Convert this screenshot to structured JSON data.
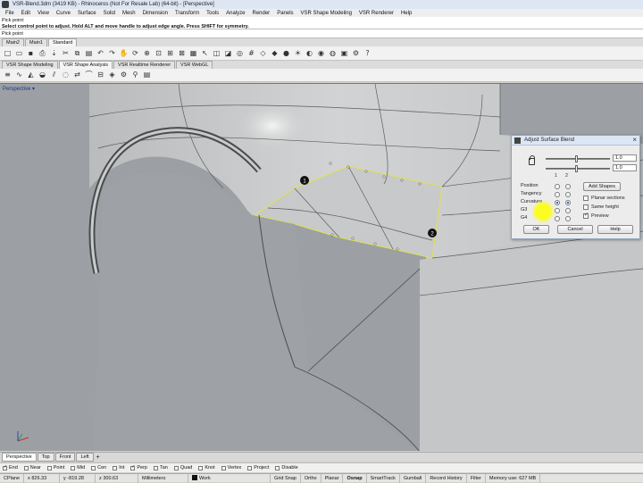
{
  "window": {
    "title": "VSR-Blend.3dm (3419 KB) - Rhinoceros (Not For Resale Lab) (64-bit) - [Perspective]"
  },
  "menu": [
    "File",
    "Edit",
    "View",
    "Curve",
    "Surface",
    "Solid",
    "Mesh",
    "Dimension",
    "Transform",
    "Tools",
    "Analyze",
    "Render",
    "Panels",
    "VSR Shape Modeling",
    "VSR Renderer",
    "Help"
  ],
  "command": {
    "history_line": "Pick point:",
    "message": "Select control point to adjust. Hold ALT and move handle to adjust edge angle. Press SHIFT for symmetry.",
    "prompt": "Pick point"
  },
  "toolbar_tabs_top": [
    "Main2",
    "Main1",
    "Standard"
  ],
  "toolbar_tabs_top_active": 2,
  "toolbar_tabs_vsr": [
    "VSR Shape Modeling",
    "VSR Shape Analysis",
    "VSR Realtime Renderer",
    "VSR WebGL"
  ],
  "toolbar_tabs_vsr_active": 1,
  "viewport": {
    "label": "Perspective",
    "markers": [
      "1",
      "2"
    ]
  },
  "dialog": {
    "title": "Adjust Surface Blend",
    "field1": "1.0",
    "field2": "1.0",
    "column_headers": [
      "1",
      "2"
    ],
    "rows": [
      "Position",
      "Tangency",
      "Curvature",
      "G3",
      "G4"
    ],
    "selected_side1": "Curvature",
    "selected_side2": "Curvature",
    "add_shapes": "Add Shapes",
    "checkboxes": [
      {
        "label": "Planar sections",
        "checked": false
      },
      {
        "label": "Same height",
        "checked": false
      },
      {
        "label": "Preview",
        "checked": true
      }
    ],
    "ok": "OK",
    "cancel": "Cancel",
    "help": "Help"
  },
  "view_tabs": [
    "Perspective",
    "Top",
    "Front",
    "Left"
  ],
  "view_tabs_active": 0,
  "osnaps": [
    {
      "label": "End",
      "checked": true
    },
    {
      "label": "Near",
      "checked": false
    },
    {
      "label": "Point",
      "checked": false
    },
    {
      "label": "Mid",
      "checked": false
    },
    {
      "label": "Cen",
      "checked": false
    },
    {
      "label": "Int",
      "checked": false
    },
    {
      "label": "Perp",
      "checked": true
    },
    {
      "label": "Tan",
      "checked": false
    },
    {
      "label": "Quad",
      "checked": false
    },
    {
      "label": "Knot",
      "checked": false
    },
    {
      "label": "Vertex",
      "checked": false
    },
    {
      "label": "Project",
      "checked": false
    },
    {
      "label": "Disable",
      "checked": false
    }
  ],
  "status": {
    "cplane": "CPlane",
    "x": "x 826.33",
    "y": "y -819.28",
    "z": "z 300.63",
    "units": "Millimeters",
    "layer": "Work",
    "grid_snap": "Grid Snap",
    "ortho": "Ortho",
    "planar": "Planar",
    "osnap": "Osnap",
    "smarttrack": "SmartTrack",
    "gumball": "Gumball",
    "record_history": "Record History",
    "filter": "Filter",
    "memory": "Memory use: 627 MB"
  },
  "colors": {
    "viewport_bg": "#9ca0a4",
    "surface": "#c9c9c9",
    "highlight": "#ffff00",
    "blend_edge": "#e0e040"
  }
}
